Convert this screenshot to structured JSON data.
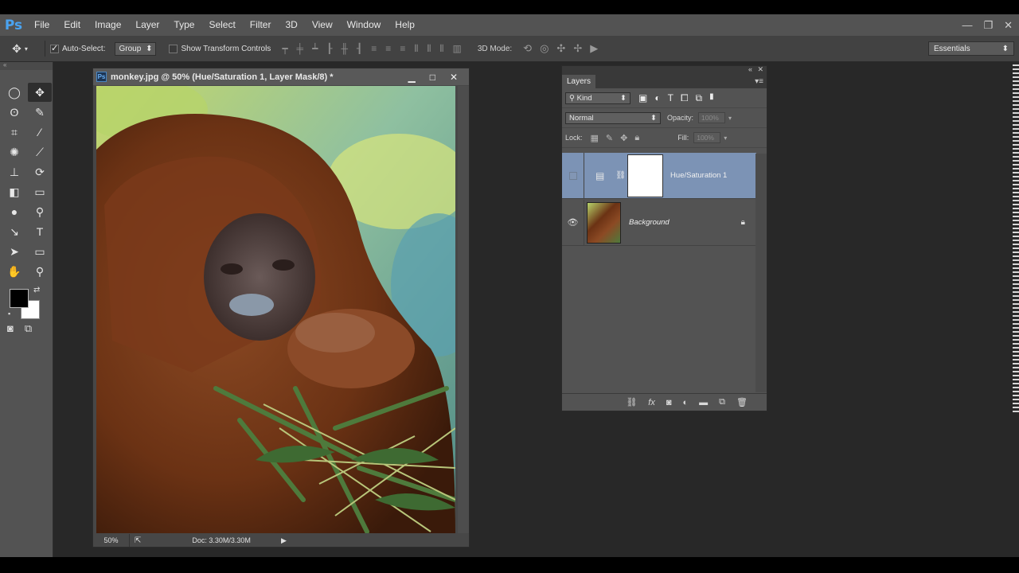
{
  "app": {
    "logo": "Ps",
    "menu": [
      "File",
      "Edit",
      "Image",
      "Layer",
      "Type",
      "Select",
      "Filter",
      "3D",
      "View",
      "Window",
      "Help"
    ],
    "window_controls": [
      "—",
      "❐",
      "✕"
    ]
  },
  "options_bar": {
    "tool_icon": "move-tool-icon",
    "auto_select_label": "Auto-Select:",
    "auto_select_checked": true,
    "auto_select_value": "Group",
    "show_transform_label": "Show Transform Controls",
    "show_transform_checked": false,
    "three_d_mode_label": "3D Mode:",
    "workspace": "Essentials"
  },
  "tools": [
    {
      "name": "marquee-tool-icon",
      "glyph": "◯"
    },
    {
      "name": "move-tool-icon",
      "glyph": "✥"
    },
    {
      "name": "lasso-tool-icon",
      "glyph": "ʘ"
    },
    {
      "name": "quick-selection-tool-icon",
      "glyph": "✎"
    },
    {
      "name": "crop-tool-icon",
      "glyph": "⌗"
    },
    {
      "name": "eyedropper-tool-icon",
      "glyph": "⁄"
    },
    {
      "name": "healing-brush-tool-icon",
      "glyph": "✺"
    },
    {
      "name": "brush-tool-icon",
      "glyph": "⟋"
    },
    {
      "name": "clone-stamp-tool-icon",
      "glyph": "⊥"
    },
    {
      "name": "history-brush-tool-icon",
      "glyph": "⟳"
    },
    {
      "name": "eraser-tool-icon",
      "glyph": "◧"
    },
    {
      "name": "gradient-tool-icon",
      "glyph": "▭"
    },
    {
      "name": "blur-tool-icon",
      "glyph": "●"
    },
    {
      "name": "dodge-tool-icon",
      "glyph": "⚲"
    },
    {
      "name": "pen-tool-icon",
      "glyph": "↘"
    },
    {
      "name": "type-tool-icon",
      "glyph": "T"
    },
    {
      "name": "path-selection-tool-icon",
      "glyph": "➤"
    },
    {
      "name": "rectangle-tool-icon",
      "glyph": "▭"
    },
    {
      "name": "hand-tool-icon",
      "glyph": "✋"
    },
    {
      "name": "zoom-tool-icon",
      "glyph": "⚲"
    }
  ],
  "document": {
    "title": "monkey.jpg @ 50% (Hue/Saturation 1, Layer Mask/8) *",
    "zoom": "50%",
    "doc_info": "Doc: 3.30M/3.30M"
  },
  "layers_panel": {
    "tab": "Layers",
    "filter_kind": "Kind",
    "blend_mode": "Normal",
    "opacity_label": "Opacity:",
    "opacity_value": "100%",
    "lock_label": "Lock:",
    "fill_label": "Fill:",
    "fill_value": "100%",
    "layers": [
      {
        "name": "Hue/Saturation 1",
        "selected": true,
        "visible": false
      },
      {
        "name": "Background",
        "selected": false,
        "visible": true,
        "locked": true
      }
    ]
  },
  "colors": {
    "foreground": "#000000",
    "background": "#ffffff",
    "selection": "#7c93b5"
  }
}
